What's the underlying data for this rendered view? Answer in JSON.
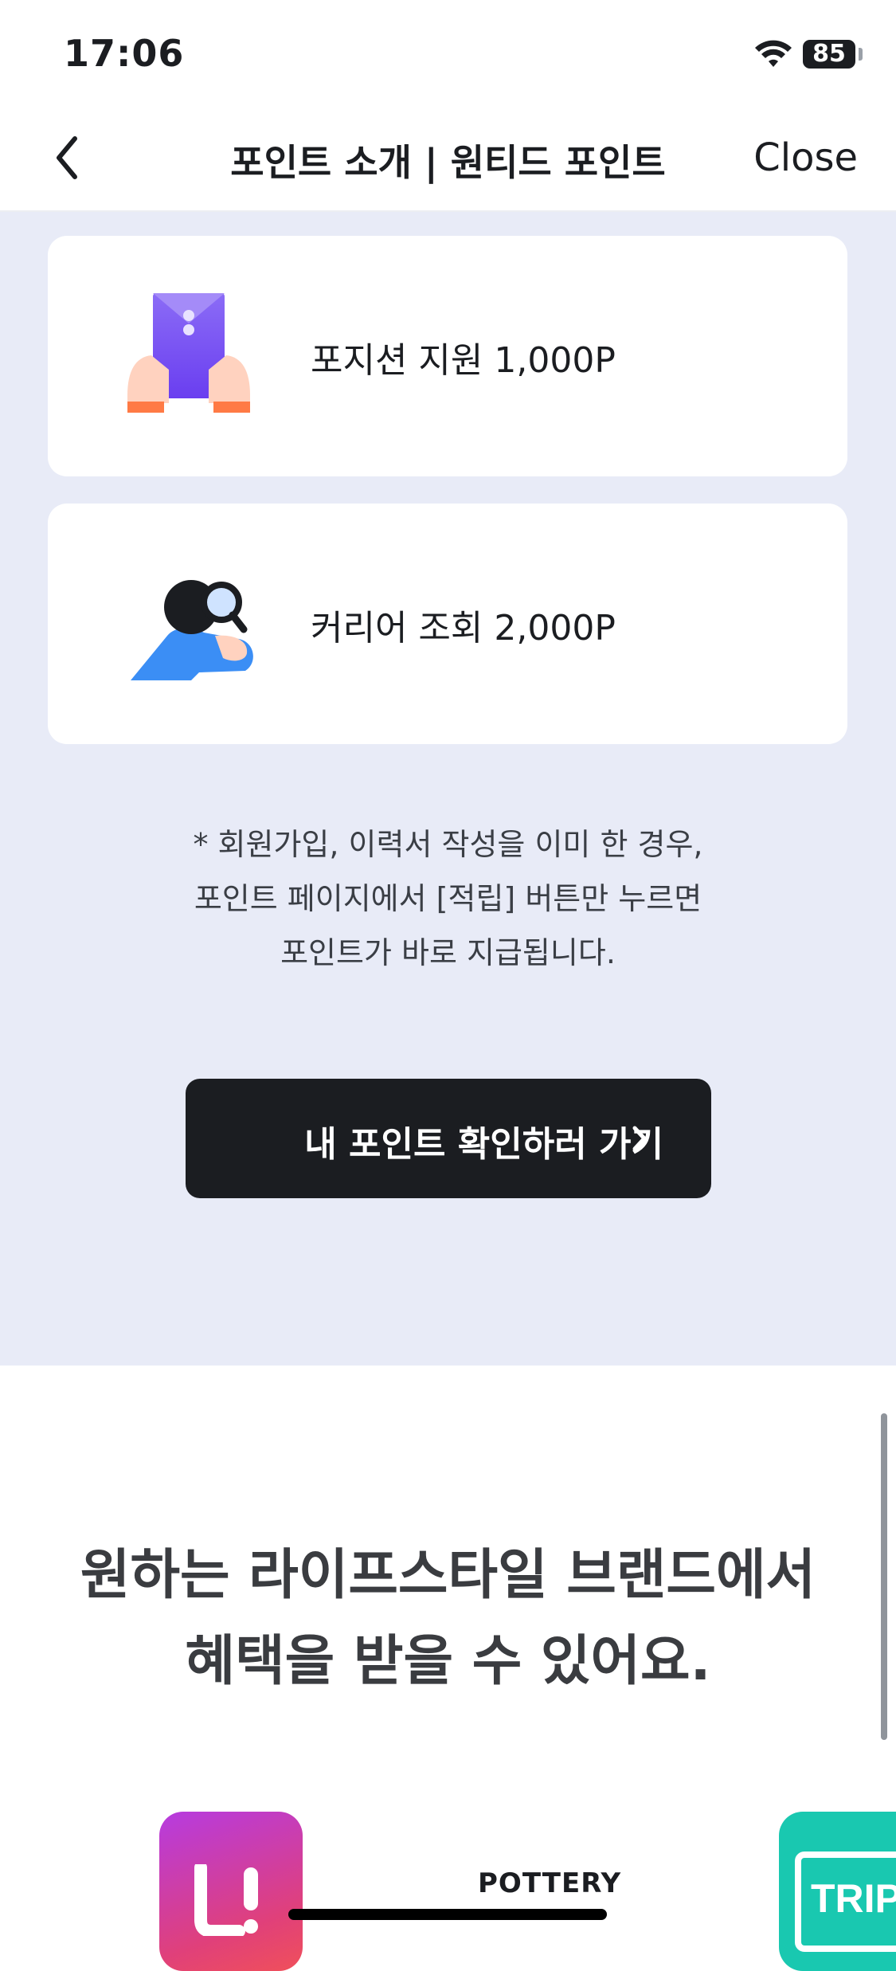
{
  "status_bar": {
    "time": "17:06",
    "battery": "85",
    "icons": [
      "wifi-icon",
      "battery-icon"
    ]
  },
  "nav": {
    "title": "포인트 소개 | 원티드 포인트",
    "close_label": "Close",
    "back_icon": "chevron-left-icon"
  },
  "reward_cards": [
    {
      "icon": "envelope-hands-icon",
      "label": "포지션 지원 1,000P"
    },
    {
      "icon": "career-search-icon",
      "label": "커리어 조회 2,000P"
    }
  ],
  "note_lines": [
    "* 회원가입, 이력서 작성을 이미 한 경우,",
    "포인트 페이지에서 [적립] 버튼만 누르면",
    "포인트가 바로 지급됩니다."
  ],
  "cta": {
    "label": "내 포인트 확인하러 가기",
    "icon": "chevron-right-icon"
  },
  "lifestyle": {
    "headline_lines": [
      "원하는 라이프스타일 브랜드에서",
      "혜택을 받을 수 있어요."
    ],
    "brands": [
      {
        "name": "L!",
        "icon": "brand-l-logo"
      },
      {
        "name": "POTTERY"
      },
      {
        "name": "TRIP"
      }
    ]
  },
  "colors": {
    "section_bg": "#e8ebf7",
    "cta_bg": "#1b1d21",
    "card_bg": "#ffffff",
    "accent_blue": "#3b8ef5",
    "accent_purple": "#7b52f0"
  }
}
